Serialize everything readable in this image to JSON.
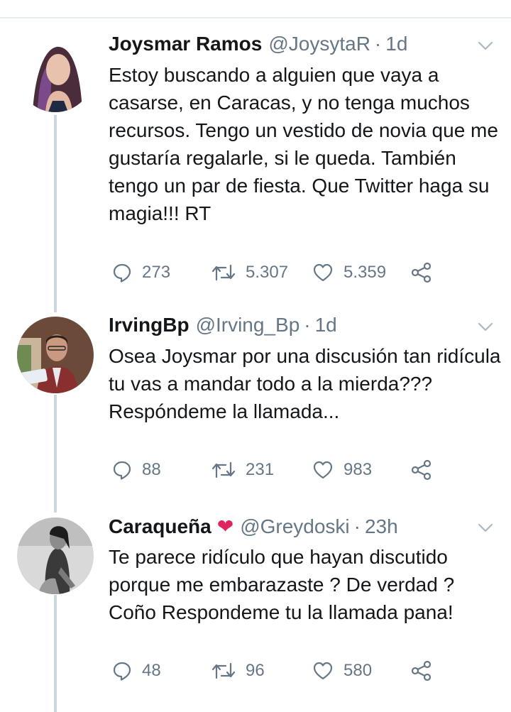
{
  "tweets": [
    {
      "name": "Joysmar Ramos",
      "has_heart": false,
      "handle": "@JoysytaR",
      "separator": "·",
      "time": "1d",
      "text": "Estoy buscando a alguien que vaya a casarse, en Caracas, y no tenga muchos recursos. Tengo un vestido de novia que me gustaría regalarle, si le queda. También tengo un par de fiesta. Que Twitter haga su magia!!! RT",
      "replies": "273",
      "retweets": "5.307",
      "likes": "5.359"
    },
    {
      "name": "IrvingBp",
      "has_heart": false,
      "handle": "@Irving_Bp",
      "separator": "·",
      "time": "1d",
      "text": "Osea Joysmar por una discusión tan ridícula tu vas a mandar todo a la mierda??? Respóndeme la llamada...",
      "replies": "88",
      "retweets": "231",
      "likes": "983"
    },
    {
      "name": "Caraqueña",
      "has_heart": true,
      "heart": "❤",
      "handle": "@Greydoski",
      "separator": "·",
      "time": "23h",
      "text": "Te parece ridículo que hayan discutido porque me embarazaste ? De verdad ? Coño Respondeme tu la llamada pana!",
      "replies": "48",
      "retweets": "96",
      "likes": "580"
    }
  ],
  "icons": {
    "reply": "reply-icon",
    "retweet": "retweet-icon",
    "like": "like-icon",
    "share": "share-icon",
    "more": "chevron-down-icon"
  },
  "colors": {
    "text": "#14171a",
    "secondary": "#657786",
    "thread_line": "#ccd6dd",
    "heart": "#e0245e"
  }
}
